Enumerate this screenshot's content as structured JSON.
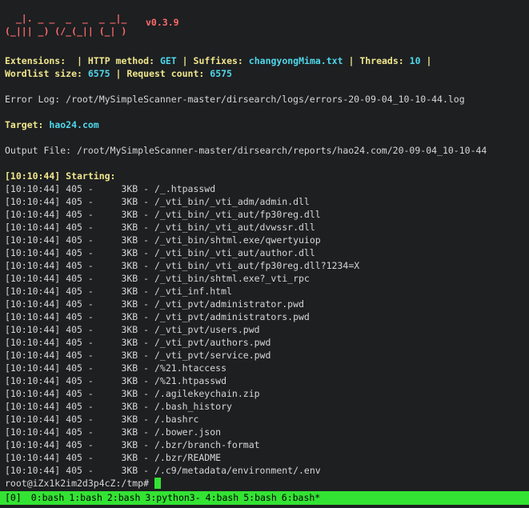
{
  "banner": {
    "row1": "  _|. _ _  _  _  _ _|_",
    "row2": "(_||| _) (/_(_|| (_| )",
    "version": "v0.3.9"
  },
  "config": {
    "extensions_label": "Extensions:",
    "extensions_value": " ",
    "http_method_label": "HTTP method:",
    "http_method_value": "GET",
    "suffixes_label": "Suffixes:",
    "suffixes_value": "changyongMima.txt",
    "threads_label": "Threads:",
    "threads_value": "10",
    "wordlist_label": "Wordlist size:",
    "wordlist_value": "6575",
    "request_label": "Request count:",
    "request_value": "6575",
    "sep": "|"
  },
  "error_log": "Error Log: /root/MySimpleScanner-master/dirsearch/logs/errors-20-09-04_10-10-44.log",
  "target": {
    "label": "Target:",
    "value": "hao24.com"
  },
  "output_file": "Output File: /root/MySimpleScanner-master/dirsearch/reports/hao24.com/20-09-04_10-10-44",
  "starting": "[10:10:44] Starting:",
  "results": [
    {
      "time": "[10:10:44]",
      "status": "405",
      "size": "3KB",
      "path": "/_.htpasswd"
    },
    {
      "time": "[10:10:44]",
      "status": "405",
      "size": "3KB",
      "path": "/_vti_bin/_vti_adm/admin.dll"
    },
    {
      "time": "[10:10:44]",
      "status": "405",
      "size": "3KB",
      "path": "/_vti_bin/_vti_aut/fp30reg.dll"
    },
    {
      "time": "[10:10:44]",
      "status": "405",
      "size": "3KB",
      "path": "/_vti_bin/_vti_aut/dvwssr.dll"
    },
    {
      "time": "[10:10:44]",
      "status": "405",
      "size": "3KB",
      "path": "/_vti_bin/shtml.exe/qwertyuiop"
    },
    {
      "time": "[10:10:44]",
      "status": "405",
      "size": "3KB",
      "path": "/_vti_bin/_vti_aut/author.dll"
    },
    {
      "time": "[10:10:44]",
      "status": "405",
      "size": "3KB",
      "path": "/_vti_bin/_vti_aut/fp30reg.dll?1234=X"
    },
    {
      "time": "[10:10:44]",
      "status": "405",
      "size": "3KB",
      "path": "/_vti_bin/shtml.exe?_vti_rpc"
    },
    {
      "time": "[10:10:44]",
      "status": "405",
      "size": "3KB",
      "path": "/_vti_inf.html"
    },
    {
      "time": "[10:10:44]",
      "status": "405",
      "size": "3KB",
      "path": "/_vti_pvt/administrator.pwd"
    },
    {
      "time": "[10:10:44]",
      "status": "405",
      "size": "3KB",
      "path": "/_vti_pvt/administrators.pwd"
    },
    {
      "time": "[10:10:44]",
      "status": "405",
      "size": "3KB",
      "path": "/_vti_pvt/users.pwd"
    },
    {
      "time": "[10:10:44]",
      "status": "405",
      "size": "3KB",
      "path": "/_vti_pvt/authors.pwd"
    },
    {
      "time": "[10:10:44]",
      "status": "405",
      "size": "3KB",
      "path": "/_vti_pvt/service.pwd"
    },
    {
      "time": "[10:10:44]",
      "status": "405",
      "size": "3KB",
      "path": "/%21.htaccess"
    },
    {
      "time": "[10:10:44]",
      "status": "405",
      "size": "3KB",
      "path": "/%21.htpasswd"
    },
    {
      "time": "[10:10:44]",
      "status": "405",
      "size": "3KB",
      "path": "/.agilekeychain.zip"
    },
    {
      "time": "[10:10:44]",
      "status": "405",
      "size": "3KB",
      "path": "/.bash_history"
    },
    {
      "time": "[10:10:44]",
      "status": "405",
      "size": "3KB",
      "path": "/.bashrc"
    },
    {
      "time": "[10:10:44]",
      "status": "405",
      "size": "3KB",
      "path": "/.bower.json"
    },
    {
      "time": "[10:10:44]",
      "status": "405",
      "size": "3KB",
      "path": "/.bzr/branch-format"
    },
    {
      "time": "[10:10:44]",
      "status": "405",
      "size": "3KB",
      "path": "/.bzr/README"
    },
    {
      "time": "[10:10:44]",
      "status": "405",
      "size": "3KB",
      "path": "/.c9/metadata/environment/.env"
    }
  ],
  "prompt": "root@iZx1k2im2d3p4cZ:/tmp#",
  "tmux": {
    "session": "[0]",
    "windows": [
      "0:bash",
      "1:bash",
      "2:bash",
      "3:python3-",
      "4:bash",
      "5:bash",
      "6:bash*"
    ]
  },
  "colors": {
    "background": "#1d1f21",
    "banner": "#ff6b6b",
    "label": "#f0e68c",
    "value": "#4fd7ea",
    "statusbar": "#33e333",
    "cursor": "#34e234"
  }
}
